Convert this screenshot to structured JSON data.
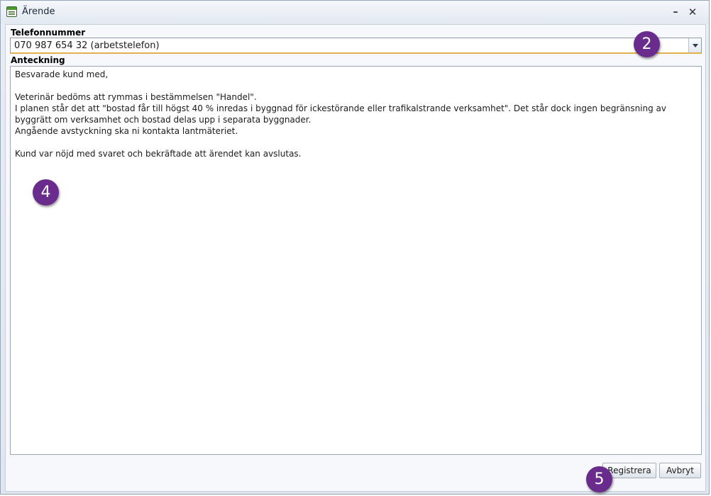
{
  "window": {
    "title": "Ärende",
    "minimize_glyph": "–",
    "close_glyph": "✕"
  },
  "phone": {
    "label": "Telefonnummer",
    "value": "070 987 654 32 (arbetstelefon)"
  },
  "note": {
    "label": "Anteckning",
    "lines": [
      "Besvarade kund med,",
      "",
      "Veterinär bedöms att rymmas i bestämmelsen \"Handel\".",
      "I planen står det att \"bostad får till högst 40 % inredas i byggnad för ickestörande eller trafikalstrande verksamhet\". Det står dock ingen begränsning av byggrätt om verksamhet och bostad delas upp i separata byggnader.",
      "Angående avstyckning ska ni kontakta lantmäteriet.",
      "",
      "Kund var nöjd med svaret och bekräftade att ärendet kan avslutas."
    ]
  },
  "buttons": {
    "register": "Registrera",
    "cancel": "Avbryt"
  },
  "badges": {
    "phone": "2",
    "note": "4",
    "buttons": "5"
  },
  "colors": {
    "badge": "#6a2c8c",
    "field_focus_underline": "#e0b14e",
    "app_icon": "#4c9a2a"
  },
  "icons": {
    "app": "document-list-icon",
    "dropdown": "chevron-down-icon"
  }
}
